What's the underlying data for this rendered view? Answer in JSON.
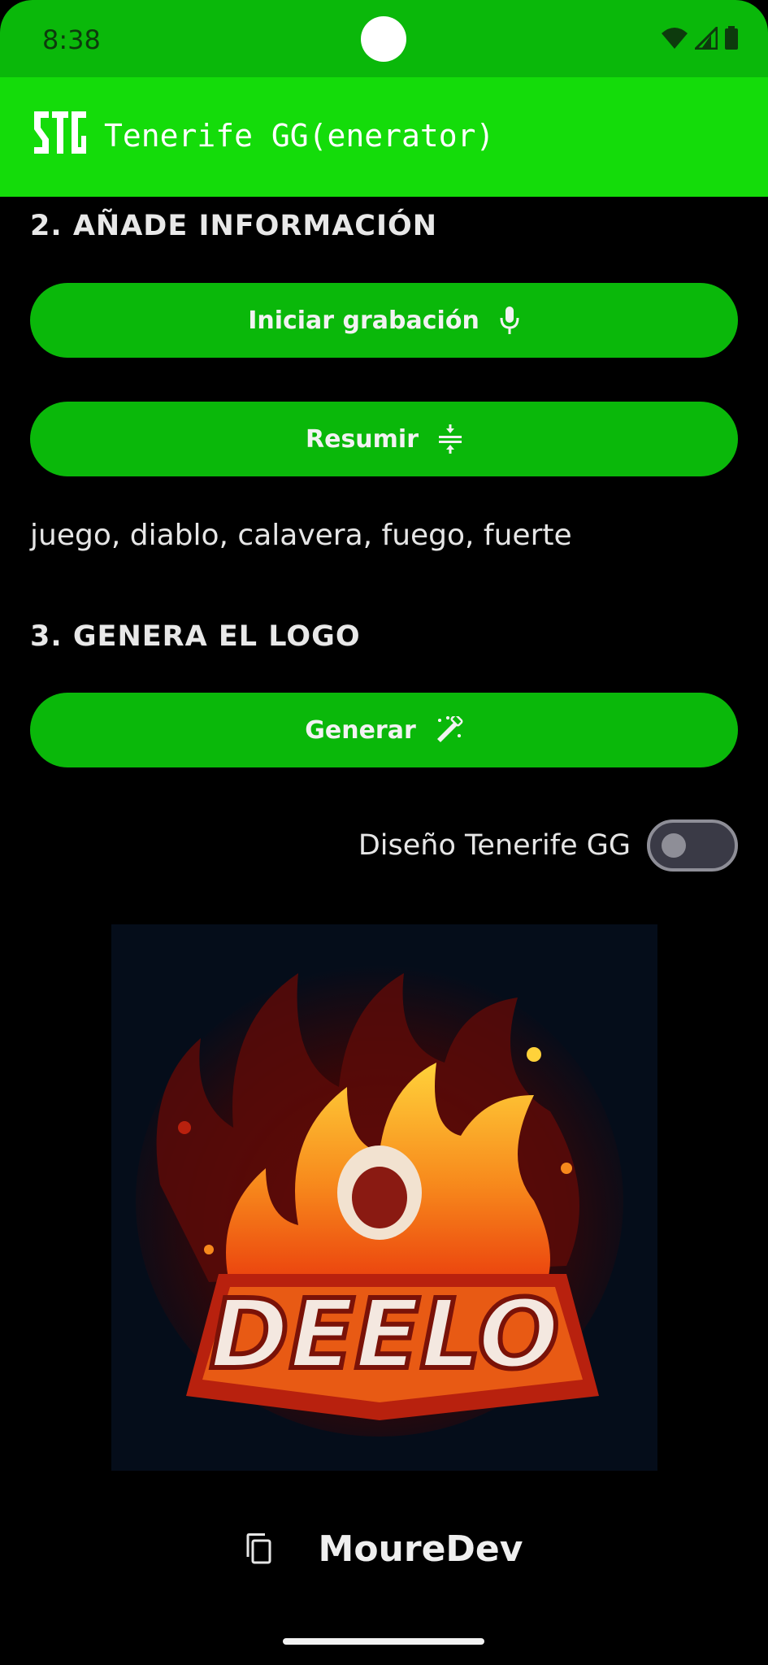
{
  "status_bar": {
    "time": "8:38",
    "icons": [
      "wifi-icon",
      "signal-icon",
      "battery-icon"
    ]
  },
  "app_bar": {
    "logo": "tenerife-gg-logo",
    "title": "Tenerife GG(enerator)"
  },
  "section_info": {
    "title": "2. AÑADE INFORMACIÓN",
    "record_button": {
      "label": "Iniciar grabación",
      "icon": "mic-icon"
    },
    "summarize_button": {
      "label": "Resumir",
      "icon": "compress-icon"
    },
    "keywords": "juego, diablo, calavera, fuego, fuerte"
  },
  "section_logo": {
    "title": "3. GENERA EL LOGO",
    "generate_button": {
      "label": "Generar",
      "icon": "magic-wand-icon"
    },
    "toggle": {
      "label": "Diseño Tenerife GG",
      "checked": false
    }
  },
  "generated_logo": {
    "wordmark": "DEELO"
  },
  "footer": {
    "copy_icon": "copy-icon",
    "name": "MoureDev"
  },
  "colors": {
    "status_bar": "#0ab80a",
    "app_bar": "#14dc0a",
    "button": "#0ab80a",
    "background": "#000000"
  }
}
